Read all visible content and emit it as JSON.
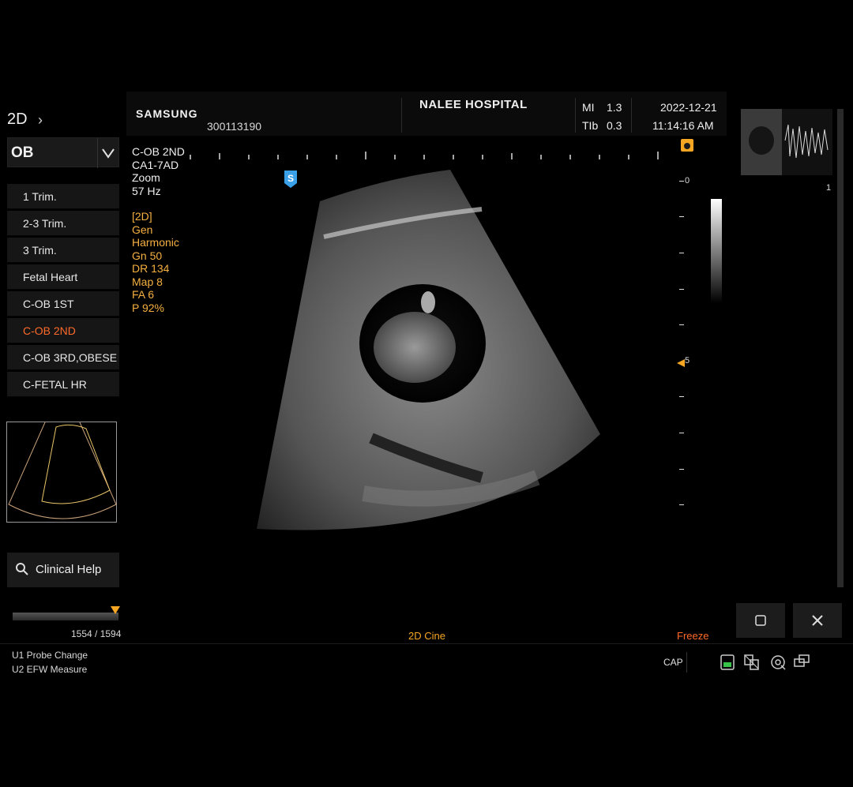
{
  "header": {
    "brand": "SAMSUNG",
    "patient_id": "300113190",
    "hospital": "NALEE HOSPITAL",
    "mi_label": "MI",
    "mi_value": "1.3",
    "tib_label": "TIb",
    "tib_value": "0.3",
    "date": "2022-12-21",
    "time": "11:14:16 AM"
  },
  "sidebar": {
    "mode": "2D",
    "application": "OB",
    "presets": [
      {
        "label": "1 Trim.",
        "active": false
      },
      {
        "label": "2-3 Trim.",
        "active": false
      },
      {
        "label": "3 Trim.",
        "active": false
      },
      {
        "label": "Fetal Heart",
        "active": false
      },
      {
        "label": "C-OB 1ST",
        "active": false
      },
      {
        "label": "C-OB 2ND",
        "active": true
      },
      {
        "label": "C-OB 3RD,OBESE",
        "active": false
      },
      {
        "label": "C-FETAL HR",
        "active": false
      }
    ],
    "clinical_help": "Clinical Help",
    "cine_counter": "1554 / 1594"
  },
  "image_info": {
    "preset": "C-OB 2ND",
    "probe": "CA1-7AD",
    "zoom": "Zoom",
    "frame_rate": "57 Hz",
    "mode_tag": "[2D]",
    "gen": "Gen",
    "harmonic": "Harmonic",
    "gain": "Gn  50",
    "dynamic_range": "DR  134",
    "map": "Map  8",
    "fa": "FA  6",
    "power": "P    92%"
  },
  "depth_scale": {
    "top": "0",
    "mid": "5"
  },
  "thumbnail_index": "1",
  "status": {
    "cine_label": "2D Cine",
    "freeze_label": "Freeze",
    "cap_label": "CAP"
  },
  "user_keys": {
    "u1": "U1  Probe Change",
    "u2": "U2  EFW Measure"
  },
  "colors": {
    "accent_orange": "#f5a623",
    "active_red": "#ff6a2a",
    "focus_blue": "#3aa0e8"
  }
}
